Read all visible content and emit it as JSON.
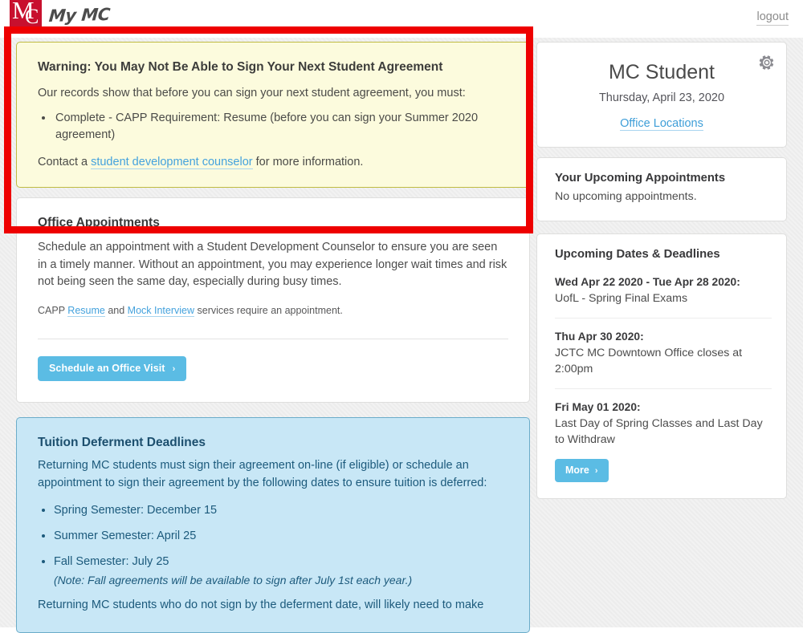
{
  "header": {
    "logo_mark_m": "M",
    "logo_mark_c": "C",
    "logo_text": "My MC",
    "logout_label": "logout"
  },
  "warning": {
    "title": "Warning: You May Not Be Able to Sign Your Next Student Agreement",
    "lead": "Our records show that before you can sign your next student agreement, you must:",
    "items": [
      "Complete - CAPP Requirement: Resume (before you can sign your Summer 2020 agreement)"
    ],
    "foot_before": "Contact a ",
    "foot_link": "student development counselor",
    "foot_after": " for more information.",
    "bg_color": "#fcfbdd",
    "border_color": "#bfbb42"
  },
  "appointments": {
    "title": "Office Appointments",
    "paragraph": "Schedule an appointment with a Student Development Counselor to ensure you are seen in a timely manner. Without an appointment, you may experience longer wait times and risk not being seen the same day, especially during busy times.",
    "note_part1": "CAPP ",
    "note_link1": "Resume",
    "note_part2": " and ",
    "note_link2": "Mock Interview",
    "note_part3": " services require an appointment.",
    "button_label": "Schedule an Office Visit",
    "button_chevron": "›",
    "button_color": "#5bbce4"
  },
  "tuition": {
    "title": "Tuition Deferment Deadlines",
    "paragraph": "Returning MC students must sign their agreement on-line (if eligible) or schedule an appointment to sign their agreement by the following dates to ensure tuition is deferred:",
    "items": [
      {
        "text": "Spring Semester: December 15",
        "note": ""
      },
      {
        "text": "Summer Semester: April 25",
        "note": ""
      },
      {
        "text": "Fall Semester: July 25",
        "note": "(Note: Fall agreements will be available to sign after July 1st each year.)"
      }
    ],
    "foot": "Returning MC students who do not sign by the deferment date, will likely need to make",
    "bg_color": "#c8e7f6",
    "border_color": "#6bacc9"
  },
  "student": {
    "gear_icon": "gear-icon",
    "name": "MC Student",
    "date": "Thursday, April 23, 2020",
    "office_locations_label": "Office Locations"
  },
  "upcoming_appointments": {
    "title": "Your Upcoming Appointments",
    "empty_text": "No upcoming appointments."
  },
  "dates_deadlines": {
    "title": "Upcoming Dates & Deadlines",
    "items": [
      {
        "label": "Wed Apr 22 2020 - Tue Apr 28 2020",
        "desc": "UofL - Spring Final Exams"
      },
      {
        "label": "Thu Apr 30 2020",
        "desc": "JCTC MC Downtown Office closes at 2:00pm"
      },
      {
        "label": "Fri May 01 2020",
        "desc": "Last Day of Spring Classes and Last Day to Withdraw"
      }
    ],
    "more_label": "More",
    "more_chevron": "›"
  },
  "annotation": {
    "color": "#ee0000"
  }
}
